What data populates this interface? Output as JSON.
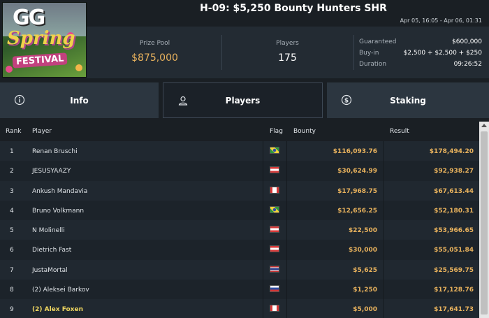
{
  "logo": {
    "line1": "GG",
    "line2": "Spring",
    "line3": "FESTIVAL"
  },
  "header": {
    "title": "H-09: $5,250 Bounty Hunters SHR",
    "dates": "Apr 05, 16:05 - Apr 06, 01:31"
  },
  "summary": {
    "prize_pool_label": "Prize Pool",
    "prize_pool_value": "$875,000",
    "players_label": "Players",
    "players_value": "175",
    "details": [
      {
        "key": "Guaranteed",
        "value": "$600,000"
      },
      {
        "key": "Buy-in",
        "value": "$2,500 + $2,500 + $250"
      },
      {
        "key": "Duration",
        "value": "09:26:52"
      }
    ]
  },
  "tabs": [
    {
      "label": "Info",
      "icon": "info-icon",
      "active": false
    },
    {
      "label": "Players",
      "icon": "user-icon",
      "active": true
    },
    {
      "label": "Staking",
      "icon": "money-icon",
      "active": false
    }
  ],
  "table": {
    "columns": {
      "rank": "Rank",
      "player": "Player",
      "flag": "Flag",
      "bounty": "Bounty",
      "result": "Result"
    },
    "rows": [
      {
        "rank": "1",
        "player": "Renan Bruschi",
        "flag": "brazil-flag",
        "bounty": "$116,093.76",
        "result": "$178,494.20",
        "highlight": false
      },
      {
        "rank": "2",
        "player": "JESUSYAAZY",
        "flag": "austria-flag",
        "bounty": "$30,624.99",
        "result": "$92,938.27",
        "highlight": false
      },
      {
        "rank": "3",
        "player": "Ankush Mandavia",
        "flag": "canada-flag",
        "bounty": "$17,968.75",
        "result": "$67,613.44",
        "highlight": false
      },
      {
        "rank": "4",
        "player": "Bruno Volkmann",
        "flag": "brazil-flag",
        "bounty": "$12,656.25",
        "result": "$52,180.31",
        "highlight": false
      },
      {
        "rank": "5",
        "player": "N Molinelli",
        "flag": "austria-flag",
        "bounty": "$22,500",
        "result": "$53,966.65",
        "highlight": false
      },
      {
        "rank": "6",
        "player": "Dietrich Fast",
        "flag": "austria-flag",
        "bounty": "$30,000",
        "result": "$55,051.84",
        "highlight": false
      },
      {
        "rank": "7",
        "player": "JustaMortal",
        "flag": "thailand-flag",
        "bounty": "$5,625",
        "result": "$25,569.75",
        "highlight": false
      },
      {
        "rank": "8",
        "player": "(2) Aleksei Barkov",
        "flag": "russia-flag",
        "bounty": "$1,250",
        "result": "$17,128.76",
        "highlight": false
      },
      {
        "rank": "9",
        "player": "(2) Alex Foxen",
        "flag": "canada-flag",
        "bounty": "$5,000",
        "result": "$17,641.73",
        "highlight": true
      }
    ]
  },
  "colors": {
    "accent_gold": "#e8b25d",
    "highlight_name": "#f0d760",
    "background": "#1a1f24"
  }
}
